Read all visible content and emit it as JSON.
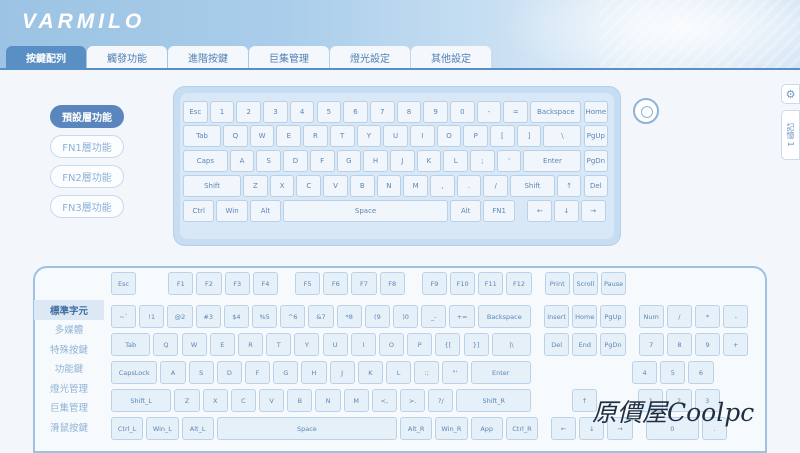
{
  "app": {
    "logo": "VARMILO"
  },
  "tabs": [
    {
      "label": "按鍵配列",
      "active": true
    },
    {
      "label": "觸發功能",
      "active": false
    },
    {
      "label": "進階按鍵",
      "active": false
    },
    {
      "label": "巨集管理",
      "active": false
    },
    {
      "label": "燈光設定",
      "active": false
    },
    {
      "label": "其他設定",
      "active": false
    }
  ],
  "layers": [
    {
      "label": "預設層功能",
      "active": true
    },
    {
      "label": "FN1層功能",
      "active": false
    },
    {
      "label": "FN2層功能",
      "active": false
    },
    {
      "label": "FN3層功能",
      "active": false
    }
  ],
  "side": {
    "gear_icon": "gear-icon",
    "memory_label": "記憶 1"
  },
  "categories": [
    {
      "label": "標準字元",
      "active": true
    },
    {
      "label": "多媒體",
      "active": false
    },
    {
      "label": "特殊按鍵",
      "active": false
    },
    {
      "label": "功能鍵",
      "active": false
    },
    {
      "label": "燈光管理",
      "active": false
    },
    {
      "label": "巨集管理",
      "active": false
    },
    {
      "label": "滑鼠按鍵",
      "active": false
    }
  ],
  "keyboard75": [
    [
      "Esc",
      "1",
      "2",
      "3",
      "4",
      "5",
      "6",
      "7",
      "8",
      "9",
      "0",
      "-",
      "=",
      "Backspace",
      "Home"
    ],
    [
      "Tab",
      "Q",
      "W",
      "E",
      "R",
      "T",
      "Y",
      "U",
      "I",
      "O",
      "P",
      "[",
      "]",
      "\\",
      "PgUp"
    ],
    [
      "Caps",
      "A",
      "S",
      "D",
      "F",
      "G",
      "H",
      "J",
      "K",
      "L",
      ";",
      "'",
      "Enter",
      "PgDn"
    ],
    [
      "Shift",
      "Z",
      "X",
      "C",
      "V",
      "B",
      "N",
      "M",
      ",",
      ".",
      "/",
      "Shift",
      "↑",
      "Del"
    ],
    [
      "Ctrl",
      "Win",
      "Alt",
      "Space",
      "Alt",
      "FN1",
      "←",
      "↓",
      "→"
    ]
  ],
  "full_keyboard": {
    "row_f": [
      "Esc",
      "F1",
      "F2",
      "F3",
      "F4",
      "F5",
      "F6",
      "F7",
      "F8",
      "F9",
      "F10",
      "F11",
      "F12",
      "Print",
      "Scroll",
      "Pause"
    ],
    "row_num": [
      "~`",
      "!1",
      "@2",
      "#3",
      "$4",
      "%5",
      "^6",
      "&7",
      "*8",
      "(9",
      ")0",
      "_-",
      "+=",
      "Backspace",
      "Insert",
      "Home",
      "PgUp",
      "Num",
      "/",
      "*",
      "-"
    ],
    "row_q": [
      "Tab",
      "Q",
      "W",
      "E",
      "R",
      "T",
      "Y",
      "U",
      "I",
      "O",
      "P",
      "{[",
      "}]",
      "|\\",
      "Del",
      "End",
      "PgDn",
      "7",
      "8",
      "9",
      "+"
    ],
    "row_a": [
      "CapsLock",
      "A",
      "S",
      "D",
      "F",
      "G",
      "H",
      "J",
      "K",
      "L",
      ":;",
      "\"'",
      "Enter",
      "4",
      "5",
      "6"
    ],
    "row_z": [
      "Shift_L",
      "Z",
      "X",
      "C",
      "V",
      "B",
      "N",
      "M",
      "<,",
      ">.",
      "?/",
      "Shift_R",
      "↑",
      "1",
      "2",
      "3"
    ],
    "row_ctrl": [
      "Ctrl_L",
      "Win_L",
      "Alt_L",
      "Space",
      "Alt_R",
      "Win_R",
      "App",
      "Ctrl_R",
      "←",
      "↓",
      "→",
      "0",
      "."
    ]
  },
  "watermark": "原價屋Coolpc"
}
